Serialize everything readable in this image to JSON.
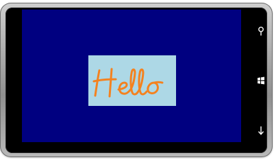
{
  "screen": {
    "background": "#000080",
    "panel": {
      "background": "#add8e6",
      "ink_color": "#f4821f",
      "text": "Hello"
    }
  },
  "device": {
    "buttons": [
      {
        "name": "search",
        "icon": "search-icon"
      },
      {
        "name": "start",
        "icon": "windows-logo-icon"
      },
      {
        "name": "back",
        "icon": "back-arrow-icon"
      }
    ]
  }
}
